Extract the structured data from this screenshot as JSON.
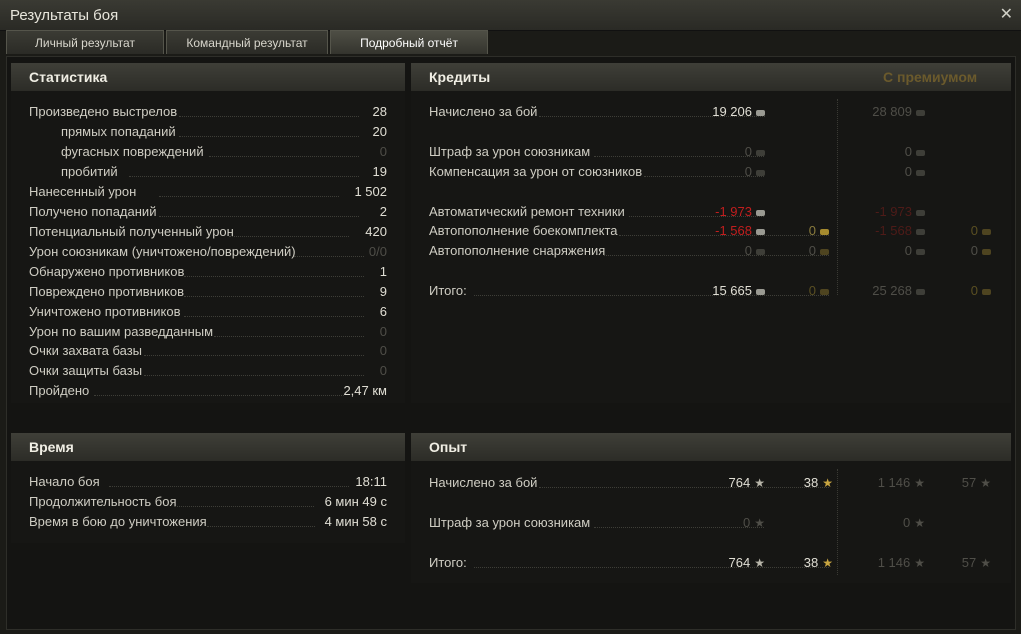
{
  "window": {
    "title": "Результаты боя"
  },
  "tabs": [
    {
      "label": "Личный результат"
    },
    {
      "label": "Командный результат"
    },
    {
      "label": "Подробный отчёт"
    }
  ],
  "statistics": {
    "header": "Статистика",
    "rows": [
      {
        "label": "Произведено выстрелов",
        "value": "28"
      },
      {
        "label": "прямых попаданий",
        "value": "20"
      },
      {
        "label": "фугасных повреждений",
        "value": "0"
      },
      {
        "label": "пробитий",
        "value": "19"
      },
      {
        "label": "Нанесенный урон",
        "value": "1 502"
      },
      {
        "label": "Получено попаданий",
        "value": "2"
      },
      {
        "label": "Потенциальный полученный урон",
        "value": "420"
      },
      {
        "label": "Урон союзникам (уничтожено/повреждений)",
        "value": "0/0"
      },
      {
        "label": "Обнаружено противников",
        "value": "1"
      },
      {
        "label": "Повреждено противников",
        "value": "9"
      },
      {
        "label": "Уничтожено противников",
        "value": "6"
      },
      {
        "label": "Урон по вашим разведданным",
        "value": "0"
      },
      {
        "label": "Очки захвата базы",
        "value": "0"
      },
      {
        "label": "Очки защиты базы",
        "value": "0"
      },
      {
        "label": "Пройдено",
        "value": "2,47 км"
      }
    ]
  },
  "credits": {
    "header": "Кредиты",
    "premium_header": "С премиумом",
    "rows": [
      {
        "label": "Начислено за бой",
        "base": "19 206",
        "prem": "28 809"
      },
      {
        "label": "Штраф за урон союзникам",
        "base": "0",
        "prem": "0"
      },
      {
        "label": "Компенсация за урон от союзников",
        "base": "0",
        "prem": "0"
      },
      {
        "label": "Автоматический ремонт техники",
        "base": "-1 973",
        "prem": "-1 973"
      },
      {
        "label": "Автопополнение боекомплекта",
        "base": "-1 568",
        "gold": "0",
        "prem": "-1 568",
        "prem_gold": "0"
      },
      {
        "label": "Автопополнение снаряжения",
        "base": "0",
        "gold": "0",
        "prem": "0",
        "prem_gold": "0"
      },
      {
        "label": "Итого:",
        "base": "15 665",
        "gold": "0",
        "prem": "25 268",
        "prem_gold": "0"
      }
    ]
  },
  "time": {
    "header": "Время",
    "rows": [
      {
        "label": "Начало боя",
        "value": "18:11"
      },
      {
        "label": "Продолжительность боя",
        "value": "6 мин 49 с"
      },
      {
        "label": "Время в бою до уничтожения",
        "value": "4 мин 58 с"
      }
    ]
  },
  "experience": {
    "header": "Опыт",
    "rows": [
      {
        "label": "Начислено за бой",
        "base": "764",
        "free": "38",
        "prem": "1 146",
        "prem_free": "57"
      },
      {
        "label": "Штраф за урон союзникам",
        "base": "0",
        "prem": "0"
      },
      {
        "label": "Итого:",
        "base": "764",
        "free": "38",
        "prem": "1 146",
        "prem_free": "57"
      }
    ]
  },
  "icons": {
    "credit": "credit-icon",
    "gold": "gold-icon",
    "star": "xp-star-icon",
    "close": "close-icon"
  }
}
